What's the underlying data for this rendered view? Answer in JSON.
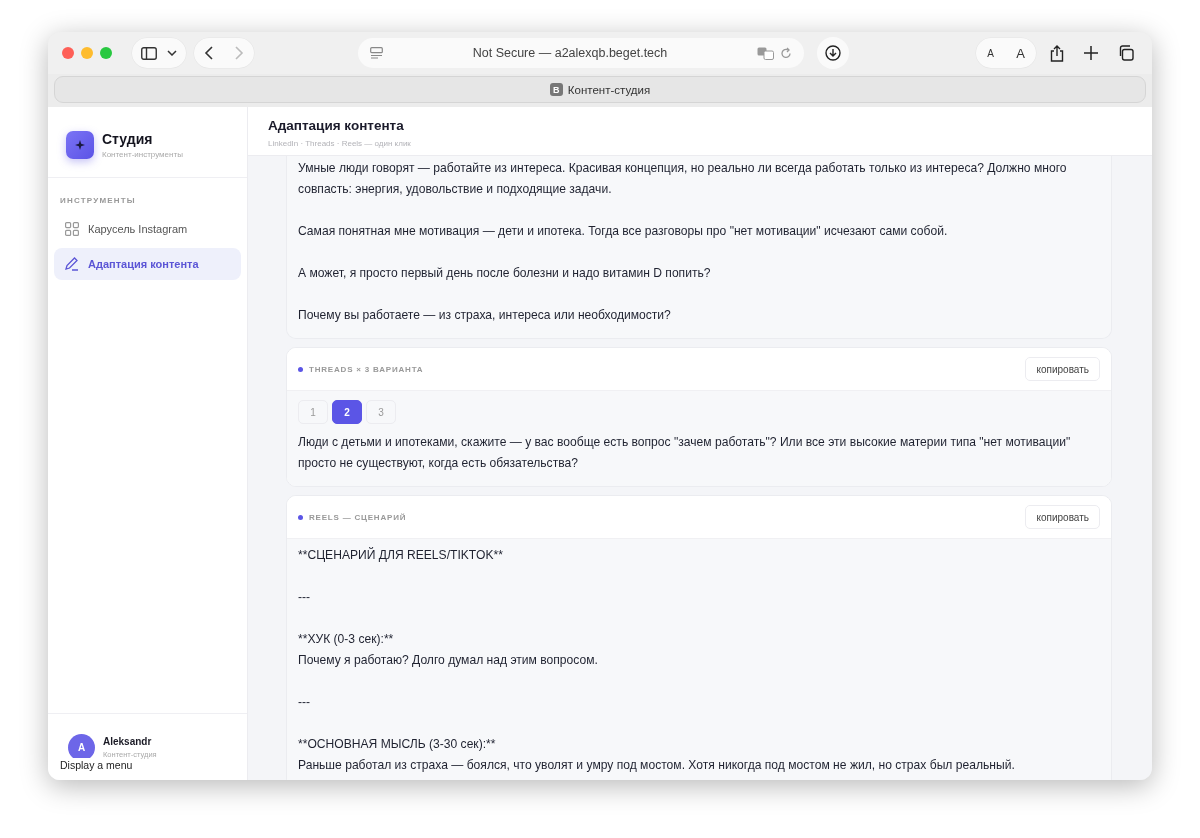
{
  "browser": {
    "address": "Not Secure — a2alexqb.beget.tech",
    "font_buttons": [
      "A",
      "A"
    ],
    "tab": {
      "favicon": "B",
      "title": "Контент-студия"
    }
  },
  "sidebar": {
    "brand": {
      "title": "Студия",
      "subtitle": "Контент-инструменты"
    },
    "section": "ИНСТРУМЕНТЫ",
    "items": [
      {
        "label": "Карусель Instagram",
        "selected": false
      },
      {
        "label": "Адаптация контента",
        "selected": true
      }
    ],
    "user": {
      "initial": "A",
      "name": "Aleksandr",
      "subtitle": "Контент-студия"
    },
    "tooltip": "Display a menu"
  },
  "header": {
    "title": "Адаптация контента",
    "subtitle": "LinkedIn · Threads · Reels — один клик"
  },
  "cards": [
    {
      "blocks": [
        [
          "Умные люди говорят — работайте из интереса. Красивая концепция, но реально ли всегда работать только из интереса? Должно много совпасть: энергия, удовольствие и подходящие задачи."
        ],
        [
          "Самая понятная мне мотивация — дети и ипотека. Тогда все разговоры про \"нет мотивации\" исчезают сами собой."
        ],
        [
          "А может, я просто первый день после болезни и надо витамин D попить?"
        ],
        [
          "Почему вы работаете — из страха, интереса или необходимости?"
        ]
      ]
    },
    {
      "label": "THREADS × 3 ВАРИАНТА",
      "copy_button": "копировать",
      "variants": [
        {
          "label": "1",
          "selected": false
        },
        {
          "label": "2",
          "selected": true
        },
        {
          "label": "3",
          "selected": false
        }
      ],
      "blocks": [
        [
          "Люди с детьми и ипотеками, скажите — у вас вообще есть вопрос \"зачем работать\"? Или все эти высокие материи типа \"нет мотивации\" просто не существуют, когда есть обязательства?"
        ]
      ]
    },
    {
      "label": "REELS — СЦЕНАРИЙ",
      "copy_button": "копировать",
      "blocks": [
        [
          "**СЦЕНАРИЙ ДЛЯ REELS/TIKTOK**"
        ],
        [
          "---"
        ],
        [
          "**ХУК (0-3 сек):**",
          "Почему я работаю? Долго думал над этим вопросом."
        ],
        [
          "---"
        ],
        [
          "**ОСНОВНАЯ МЫСЛЬ (3-30 сек):**",
          "Раньше работал из страха — боялся, что уволят и умру под мостом. Хотя никогда под мостом не жил, но страх был реальный."
        ]
      ]
    }
  ]
}
